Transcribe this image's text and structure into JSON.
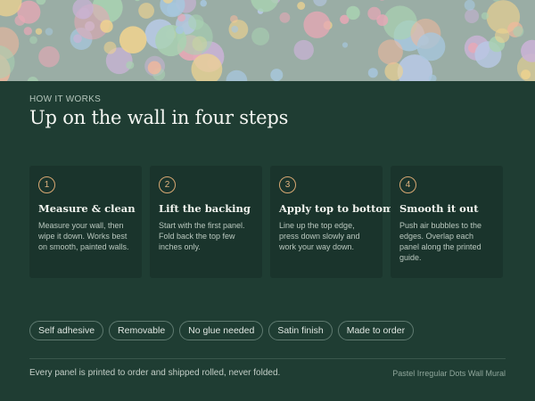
{
  "banner": {
    "pattern": "pastel-irregular-dots",
    "colors": [
      "#e7a8b6",
      "#c9b3d6",
      "#a7c7de",
      "#efd38f",
      "#a9d2b2",
      "#f0b89c",
      "#b8c9e6"
    ]
  },
  "section": {
    "eyebrow": "HOW IT WORKS",
    "title": "Up on the wall in four steps"
  },
  "steps": [
    {
      "number": "1",
      "title": "Measure & clean",
      "text": "Measure your wall, then wipe it down. Works best on smooth, painted walls."
    },
    {
      "number": "2",
      "title": "Lift the backing",
      "text": "Start with the first panel. Fold back the top few inches only."
    },
    {
      "number": "3",
      "title": "Apply top to bottom",
      "text": "Line up the top edge, press down slowly and work your way down."
    },
    {
      "number": "4",
      "title": "Smooth it out",
      "text": "Push air bubbles to the edges. Overlap each panel along the printed guide."
    }
  ],
  "tags": [
    "Self adhesive",
    "Removable",
    "No glue needed",
    "Satin finish",
    "Made to order"
  ],
  "footer": {
    "note": "Every panel is printed to order and shipped rolled, never folded.",
    "product": "Pastel Irregular Dots Wall Mural"
  },
  "colors": {
    "background": "#1f3d33",
    "card": "#1a342c",
    "accent": "#d8a872"
  }
}
